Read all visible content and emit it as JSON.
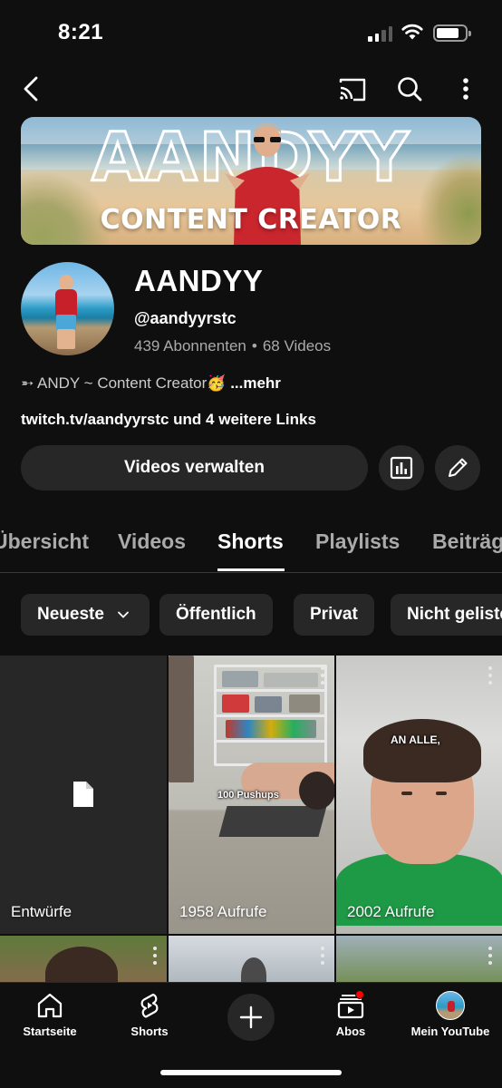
{
  "status_bar": {
    "time": "8:21"
  },
  "banner": {
    "title": "AANDYY",
    "subtitle": "CONTENT CREATOR"
  },
  "channel": {
    "name": "AANDYY",
    "handle": "@aandyyrstc",
    "subscribers": "439 Abonnenten",
    "separator": "•",
    "videos": "68 Videos",
    "description": "➵ ANDY ~ Content Creator🥳",
    "description_more": "...mehr",
    "links": "twitch.tv/aandyyrstc und 4 weitere Links"
  },
  "actions": {
    "manage": "Videos verwalten"
  },
  "tabs": [
    {
      "label": "Übersicht"
    },
    {
      "label": "Videos"
    },
    {
      "label": "Shorts",
      "active": true
    },
    {
      "label": "Playlists"
    },
    {
      "label": "Beiträge"
    }
  ],
  "chips": [
    {
      "label": "Neueste"
    },
    {
      "label": "Öffentlich"
    },
    {
      "label": "Privat"
    },
    {
      "label": "Nicht gelistet"
    }
  ],
  "shorts": [
    {
      "label": "Entwürfe",
      "icon": "document-icon"
    },
    {
      "label": "1958 Aufrufe",
      "overlay": "100 Pushups"
    },
    {
      "label": "2002 Aufrufe",
      "overlay": "AN ALLE,"
    }
  ],
  "bottom_nav": [
    {
      "label": "Startseite",
      "icon": "home-icon"
    },
    {
      "label": "Shorts",
      "icon": "shorts-icon"
    },
    {
      "label": "",
      "icon": "plus-icon"
    },
    {
      "label": "Abos",
      "icon": "subscriptions-icon"
    },
    {
      "label": "Mein YouTube",
      "icon": "avatar"
    }
  ],
  "colors": {
    "background": "#0f0f0f",
    "surface": "#272727",
    "muted_text": "#aaaaaa",
    "notification": "#ff0000"
  }
}
